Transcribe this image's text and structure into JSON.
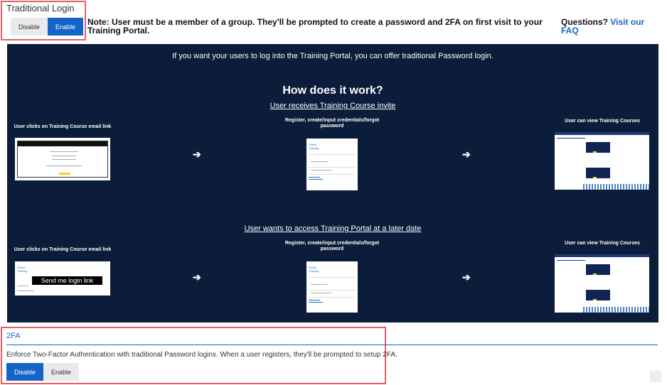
{
  "traditional_login": {
    "title": "Traditional Login",
    "disable_label": "Disable",
    "enable_label": "Enable",
    "selected": "Enable",
    "note": "Note: User must be a member of a group. They'll be prompted to create a password and 2FA on first visit to your Training Portal.",
    "questions_label": "Questions?",
    "faq_link": "Visit our FAQ"
  },
  "panel": {
    "intro": "If you want your users to log into the Training Portal, you can offer traditional Password login.",
    "how_title": "How does it work?",
    "flows": [
      {
        "heading": "User receives Training Course invite",
        "steps": [
          "User clicks on Training Course email link",
          "Register, create/input credentials/forgot password",
          "User can view Training Courses"
        ]
      },
      {
        "heading": "User wants to access Training Portal at a later date",
        "steps": [
          "User clicks on Training Course email link",
          "Register, create/input credentials/forgot password",
          "User can view Training Courses"
        ],
        "send_link_label": "Send me login link"
      }
    ],
    "arrow_glyph": "➔",
    "colors": {
      "background": "#0b1d3a",
      "accent": "#1565c9"
    }
  },
  "tfa": {
    "title": "2FA",
    "description": "Enforce Two-Factor Authentication with traditional Password logins. When a user registers, they'll be prompted to setup 2FA.",
    "disable_label": "Disable",
    "enable_label": "Enable",
    "selected": "Disable"
  }
}
